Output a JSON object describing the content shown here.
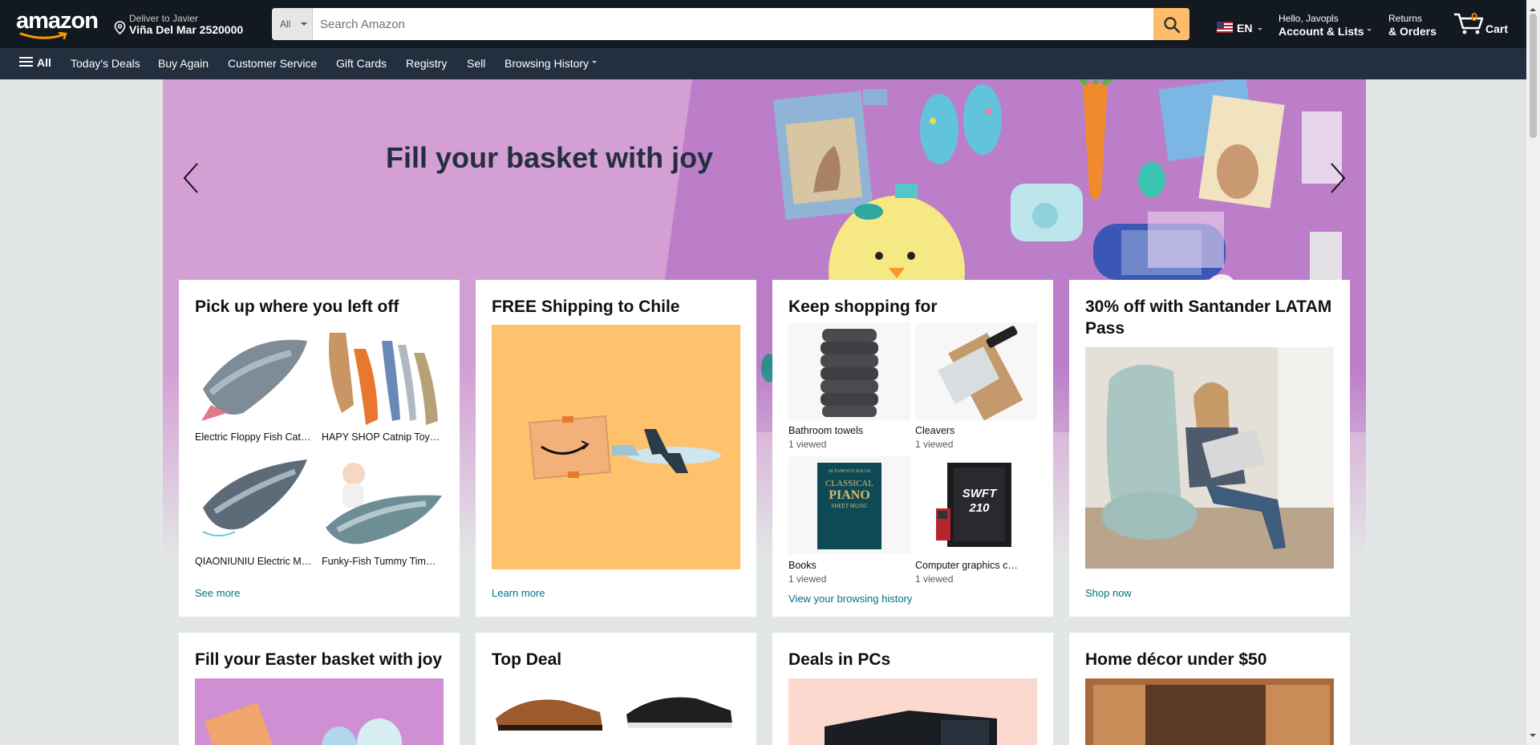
{
  "header": {
    "logo_text": "amazon",
    "deliver_line1": "Deliver to Javier",
    "deliver_line2": "Viña Del Mar 2520000",
    "search_category": "All",
    "search_placeholder": "Search Amazon",
    "language": "EN",
    "account_line1": "Hello, Javopls",
    "account_line2": "Account & Lists",
    "returns_line1": "Returns",
    "returns_line2": "& Orders",
    "cart_count": "0",
    "cart_label": "Cart"
  },
  "subnav": {
    "all": "All",
    "items": [
      "Today's Deals",
      "Buy Again",
      "Customer Service",
      "Gift Cards",
      "Registry",
      "Sell",
      "Browsing History"
    ]
  },
  "hero": {
    "title": "Fill your basket with joy",
    "colors": {
      "background": "#d49fd4",
      "title": "#232f3e"
    }
  },
  "cards": [
    {
      "title": "Pick up where you left off",
      "items": [
        "Electric Floppy Fish Cat…",
        "HAPY SHOP Catnip Toy…",
        "QIAONIUNIU Electric M…",
        "Funky-Fish Tummy Tim…"
      ],
      "link": "See more"
    },
    {
      "title": "FREE Shipping to Chile",
      "link": "Learn more"
    },
    {
      "title": "Keep shopping for",
      "items": [
        {
          "label": "Bathroom towels",
          "sub": "1 viewed"
        },
        {
          "label": "Cleavers",
          "sub": "1 viewed"
        },
        {
          "label": "Books",
          "sub": "1 viewed"
        },
        {
          "label": "Computer graphics c…",
          "sub": "1 viewed"
        }
      ],
      "book_cover_text": [
        "60 FAMOUS SOLOS",
        "CLASSICAL",
        "PIANO",
        "SHEET MUSIC"
      ],
      "gpu_text": "SWFT 210",
      "link": "View your browsing history"
    },
    {
      "title": "30% off with Santander LATAM Pass",
      "link": "Shop now"
    }
  ],
  "cards_row2": [
    {
      "title": "Fill your Easter basket with joy"
    },
    {
      "title": "Top Deal"
    },
    {
      "title": "Deals in PCs"
    },
    {
      "title": "Home décor under $50"
    }
  ],
  "colors": {
    "nav_top": "#131921",
    "nav_sub": "#232f3e",
    "search_button": "#febd69",
    "link": "#007185",
    "cart_count": "#f08804",
    "page_bg": "#e3e6e6"
  }
}
